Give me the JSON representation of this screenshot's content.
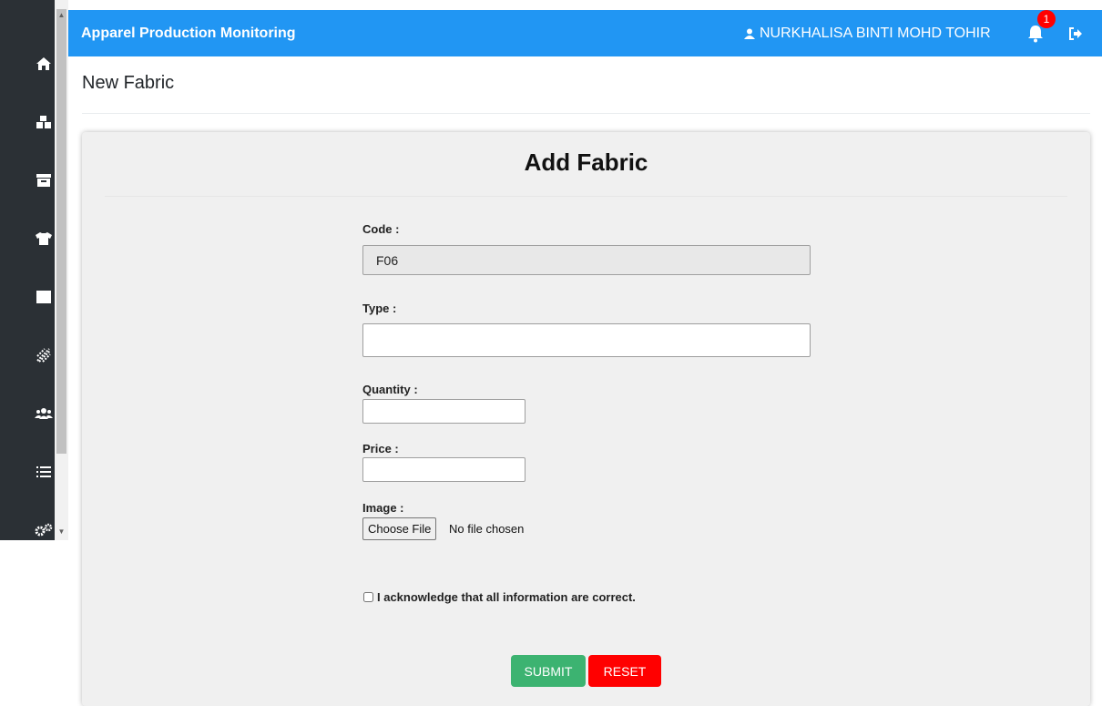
{
  "app": {
    "title": "Apparel Production Monitoring"
  },
  "header": {
    "user_name": "NURKHALISA BINTI MOHD TOHIR",
    "notification_count": "1"
  },
  "sidebar": {
    "icons": [
      "home-icon",
      "boxes-icon",
      "archive-icon",
      "shirt-icon",
      "square-icon",
      "fabric-pattern-icon",
      "users-icon",
      "list-icon",
      "settings-icon"
    ]
  },
  "page": {
    "title": "New Fabric"
  },
  "form": {
    "title": "Add Fabric",
    "code_label": "Code :",
    "code_value": "F06",
    "type_label": "Type :",
    "type_value": "",
    "quantity_label": "Quantity :",
    "quantity_value": "",
    "price_label": "Price :",
    "price_value": "",
    "image_label": "Image :",
    "file_button": "Choose File",
    "file_status": "No file chosen",
    "acknowledge_text": "I acknowledge that all information are correct.",
    "submit_label": "SUBMIT",
    "reset_label": "RESET"
  },
  "colors": {
    "topbar": "#2196f3",
    "sidebar": "#2b3035",
    "submit": "#3cb371",
    "reset": "#ff0000"
  }
}
